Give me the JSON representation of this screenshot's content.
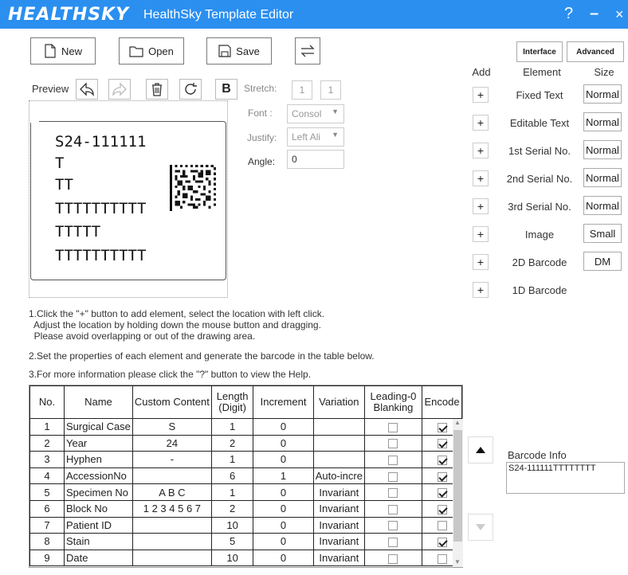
{
  "window": {
    "logo": "HEALTHSKY",
    "title": "HealthSky Template Editor",
    "help": "?",
    "minimize": "–",
    "close": "×"
  },
  "toolbar": {
    "new_label": "New",
    "open_label": "Open",
    "save_label": "Save"
  },
  "preview": {
    "label": "Preview",
    "b_label": "B",
    "stretch_label": "Stretch:",
    "stretch_x": "1",
    "stretch_y": "1",
    "font_label": "Font :",
    "font_value": "Consol",
    "justify_label": "Justify:",
    "justify_value": "Left Ali",
    "angle_label": "Angle:",
    "angle_value": "0"
  },
  "label_canvas": {
    "lines": [
      "S24-111111",
      "T",
      "TT",
      "TTTTTTTTTT",
      "TTTTT",
      "TTTTTTTTTT"
    ]
  },
  "instructions": {
    "step1": "1.Click the \"+\" button to add element, select the location with left click.\n  Adjust the location by holding down the mouse button and dragging.\n  Please avoid overlapping or out of the drawing area.",
    "step2": "2.Set the properties of each element and generate the barcode in the table below.",
    "step3": "3.For more information please click the \"?\" button to view the Help."
  },
  "mode_tabs": {
    "interface": "Interface",
    "advanced": "Advanced"
  },
  "elements_panel": {
    "add_header": "Add",
    "element_header": "Element",
    "size_header": "Size",
    "items": [
      {
        "name": "Fixed Text",
        "size": "Normal"
      },
      {
        "name": "Editable Text",
        "size": "Normal"
      },
      {
        "name": "1st Serial No.",
        "size": "Normal"
      },
      {
        "name": "2nd Serial No.",
        "size": "Normal"
      },
      {
        "name": "3rd Serial No.",
        "size": "Normal"
      },
      {
        "name": "Image",
        "size": "Small"
      },
      {
        "name": "2D Barcode",
        "size": "DM"
      },
      {
        "name": "1D Barcode",
        "size": ""
      }
    ]
  },
  "table": {
    "headers": [
      "No.",
      "Name",
      "Custom Content",
      "Length (Digit)",
      "Increment",
      "Variation",
      "Leading-0 Blanking",
      "Encode"
    ],
    "rows": [
      {
        "no": "1",
        "name": "Surgical Case",
        "custom": "S",
        "length": "1",
        "increment": "0",
        "variation": "",
        "leading0": false,
        "encode": true
      },
      {
        "no": "2",
        "name": "Year",
        "custom": "24",
        "length": "2",
        "increment": "0",
        "variation": "",
        "leading0": false,
        "encode": true
      },
      {
        "no": "3",
        "name": "Hyphen",
        "custom": "-",
        "length": "1",
        "increment": "0",
        "variation": "",
        "leading0": false,
        "encode": true
      },
      {
        "no": "4",
        "name": "AccessionNo",
        "custom": "",
        "length": "6",
        "increment": "1",
        "variation": "Auto-incre",
        "leading0": false,
        "encode": true
      },
      {
        "no": "5",
        "name": "Specimen No",
        "custom": "A B C",
        "length": "1",
        "increment": "0",
        "variation": "Invariant",
        "leading0": false,
        "encode": true
      },
      {
        "no": "6",
        "name": "Block No",
        "custom": "1 2 3 4 5 6 7",
        "length": "2",
        "increment": "0",
        "variation": "Invariant",
        "leading0": false,
        "encode": true
      },
      {
        "no": "7",
        "name": "Patient ID",
        "custom": "",
        "length": "10",
        "increment": "0",
        "variation": "Invariant",
        "leading0": false,
        "encode": false
      },
      {
        "no": "8",
        "name": "Stain",
        "custom": "",
        "length": "5",
        "increment": "0",
        "variation": "Invariant",
        "leading0": false,
        "encode": true
      },
      {
        "no": "9",
        "name": "Date",
        "custom": "",
        "length": "10",
        "increment": "0",
        "variation": "Invariant",
        "leading0": false,
        "encode": false
      }
    ]
  },
  "barcode_info": {
    "label": "Barcode Info",
    "value": "S24-111111TTTTTTTT"
  },
  "colors": {
    "titlebar": "#2b8ff0"
  },
  "icons": {
    "new": "new-file-icon",
    "open": "folder-icon",
    "save": "floppy-disk-icon",
    "swap": "swap-arrows-icon",
    "undo": "undo-arrow-icon",
    "redo": "redo-arrow-icon",
    "delete": "trash-icon",
    "refresh": "refresh-icon"
  }
}
